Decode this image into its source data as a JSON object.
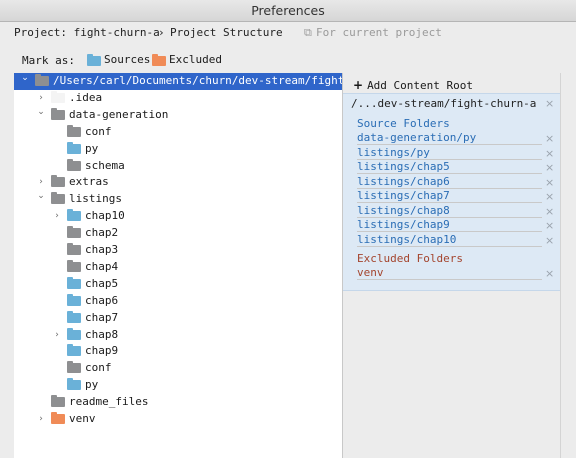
{
  "window": {
    "title": "Preferences"
  },
  "breadcrumb": {
    "project": "Project: fight-churn-a",
    "separator": "›",
    "page": "Project Structure",
    "scope_icon": "copy-icon",
    "scope": "For current project"
  },
  "mark_as": {
    "label": "Mark as:",
    "sources": "Sources",
    "excluded": "Excluded"
  },
  "tree": [
    {
      "label": "/Users/carl/Documents/churn/dev-stream/fight-chu",
      "depth": 0,
      "arrow": "open",
      "folder": "gray",
      "selected": true
    },
    {
      "label": ".idea",
      "depth": 1,
      "arrow": "closed",
      "folder": "white"
    },
    {
      "label": "data-generation",
      "depth": 1,
      "arrow": "open",
      "folder": "gray"
    },
    {
      "label": "conf",
      "depth": 2,
      "arrow": "",
      "folder": "gray"
    },
    {
      "label": "py",
      "depth": 2,
      "arrow": "",
      "folder": "blue"
    },
    {
      "label": "schema",
      "depth": 2,
      "arrow": "",
      "folder": "gray"
    },
    {
      "label": "extras",
      "depth": 1,
      "arrow": "closed",
      "folder": "gray"
    },
    {
      "label": "listings",
      "depth": 1,
      "arrow": "open",
      "folder": "gray"
    },
    {
      "label": "chap10",
      "depth": 2,
      "arrow": "closed",
      "folder": "blue"
    },
    {
      "label": "chap2",
      "depth": 2,
      "arrow": "",
      "folder": "gray"
    },
    {
      "label": "chap3",
      "depth": 2,
      "arrow": "",
      "folder": "gray"
    },
    {
      "label": "chap4",
      "depth": 2,
      "arrow": "",
      "folder": "gray"
    },
    {
      "label": "chap5",
      "depth": 2,
      "arrow": "",
      "folder": "blue"
    },
    {
      "label": "chap6",
      "depth": 2,
      "arrow": "",
      "folder": "blue"
    },
    {
      "label": "chap7",
      "depth": 2,
      "arrow": "",
      "folder": "blue"
    },
    {
      "label": "chap8",
      "depth": 2,
      "arrow": "closed",
      "folder": "blue"
    },
    {
      "label": "chap9",
      "depth": 2,
      "arrow": "",
      "folder": "blue"
    },
    {
      "label": "conf",
      "depth": 2,
      "arrow": "",
      "folder": "gray"
    },
    {
      "label": "py",
      "depth": 2,
      "arrow": "",
      "folder": "blue"
    },
    {
      "label": "readme_files",
      "depth": 1,
      "arrow": "",
      "folder": "gray"
    },
    {
      "label": "venv",
      "depth": 1,
      "arrow": "closed",
      "folder": "orange"
    }
  ],
  "content_roots": {
    "add_label": "Add Content Root",
    "root_path": "/...dev-stream/fight-churn-a",
    "source_folders_title": "Source Folders",
    "source_folders": [
      "data-generation/py",
      "listings/py",
      "listings/chap5",
      "listings/chap6",
      "listings/chap7",
      "listings/chap8",
      "listings/chap9",
      "listings/chap10"
    ],
    "excluded_folders_title": "Excluded Folders",
    "excluded_folders": [
      "venv"
    ],
    "remove_glyph": "×"
  },
  "colors": {
    "selection": "#2f65ca",
    "source": "#2a6db5",
    "excluded": "#a4452e",
    "root_panel": "#dde9f5"
  }
}
